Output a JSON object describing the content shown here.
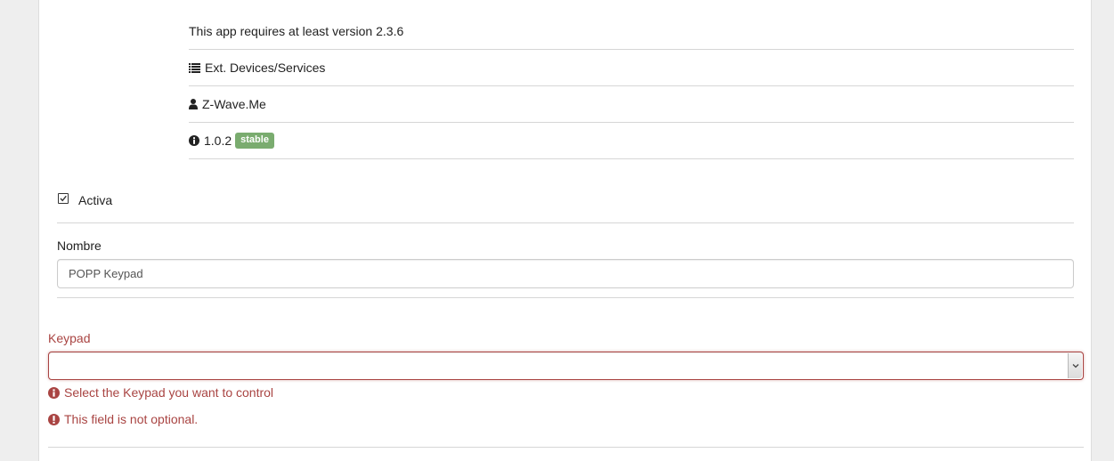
{
  "app_info": {
    "requirement": "This app requires at least version 2.3.6",
    "category": "Ext. Devices/Services",
    "author": "Z-Wave.Me",
    "version": "1.0.2",
    "version_badge": "stable",
    "category_icon": "list-icon",
    "author_icon": "user-icon",
    "version_icon": "info-circle-icon"
  },
  "form": {
    "active_label": "Activa",
    "active_checked": true,
    "name_label": "Nombre",
    "name_value": "POPP Keypad",
    "keypad_label": "Keypad",
    "keypad_value": "",
    "keypad_help": "Select the Keypad you want to control",
    "keypad_error": "This field is not optional."
  },
  "colors": {
    "error": "#a94442",
    "badge": "#7aac6f"
  }
}
